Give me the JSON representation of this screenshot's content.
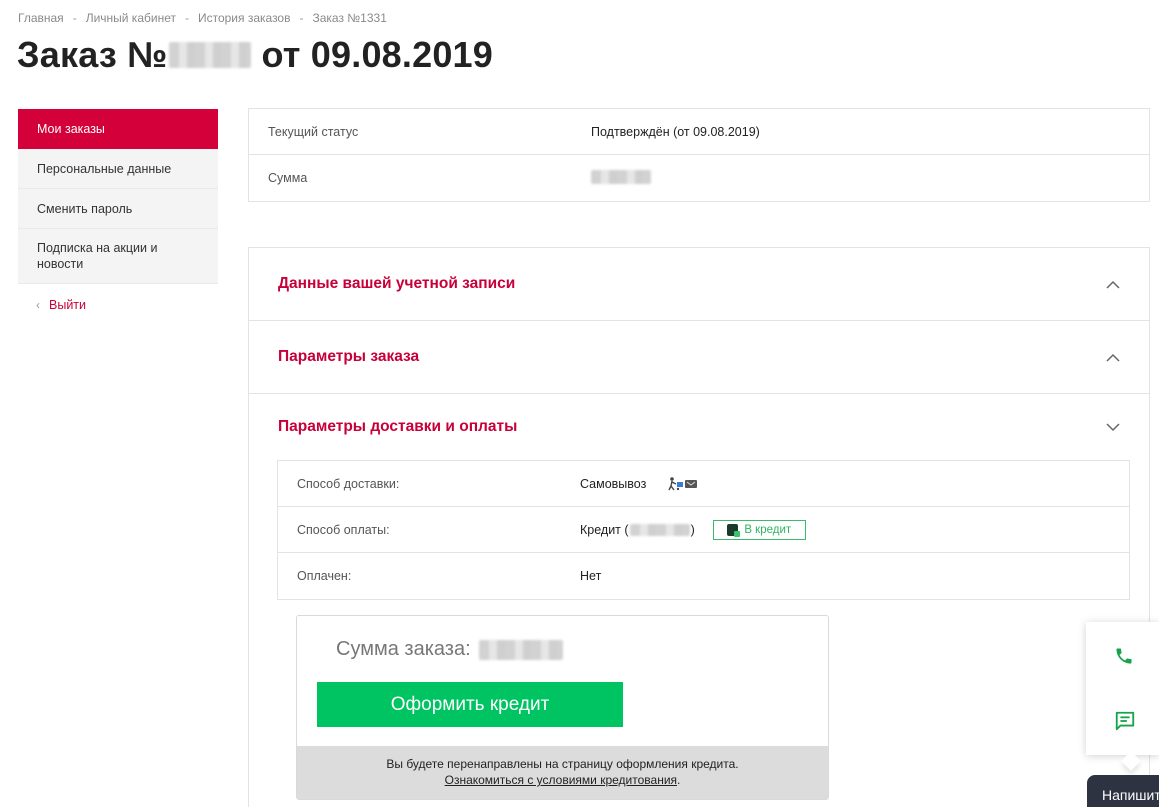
{
  "breadcrumb": {
    "items": [
      "Главная",
      "Личный кабинет",
      "История заказов",
      "Заказ №1331"
    ],
    "separator": "-"
  },
  "page": {
    "title_prefix": "Заказ №",
    "title_suffix": "от 09.08.2019"
  },
  "sidebar": {
    "items": [
      {
        "label": "Мои заказы",
        "active": true
      },
      {
        "label": "Персональные данные",
        "active": false
      },
      {
        "label": "Сменить пароль",
        "active": false
      },
      {
        "label": "Подписка на акции и новости",
        "active": false
      }
    ],
    "logout_label": "Выйти"
  },
  "status": {
    "rows": [
      {
        "label": "Текущий статус",
        "value": "Подтверждён (от 09.08.2019)"
      },
      {
        "label": "Сумма",
        "value": ""
      }
    ]
  },
  "accordion": {
    "sections": [
      {
        "title": "Данные вашей учетной записи",
        "expanded": false
      },
      {
        "title": "Параметры заказа",
        "expanded": false
      },
      {
        "title": "Параметры доставки и оплаты",
        "expanded": true
      }
    ]
  },
  "delivery": {
    "rows": [
      {
        "label": "Способ доставки:",
        "value": "Самовывоз",
        "icon": "pickup-delivery-icon"
      },
      {
        "label": "Способ оплаты:",
        "value_prefix": "Кредит (",
        "value_suffix": ")",
        "badge": "В кредит"
      },
      {
        "label": "Оплачен:",
        "value": "Нет"
      }
    ]
  },
  "credit_widget": {
    "sum_label": "Сумма заказа:",
    "button_label": "Оформить кредит",
    "note": "Вы будете перенаправлены на страницу оформления кредита.",
    "link_text": "Ознакомиться с условиями кредитования",
    "link_suffix": "."
  },
  "floating": {
    "phone_icon": "phone-icon",
    "chat_icon": "chat-icon",
    "chat_tab_label": "Напишит"
  },
  "colors": {
    "accent": "#d4003a",
    "accent_text": "#c8003a",
    "green": "#00c462",
    "float_icon": "#16a34a",
    "chat_tab": "#2d3340"
  }
}
